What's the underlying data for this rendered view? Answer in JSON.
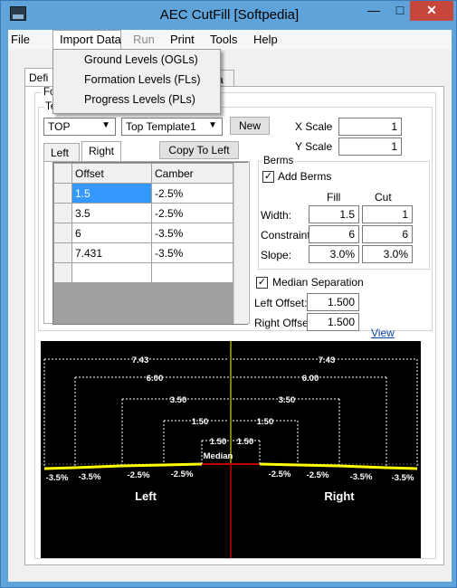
{
  "window": {
    "title": "AEC CutFill [Softpedia]"
  },
  "menu": {
    "items": [
      "File",
      "Import Data",
      "Run",
      "Print",
      "Tools",
      "Help"
    ],
    "dropdown": [
      "Ground Levels (OGLs)",
      "Formation Levels (FLs)",
      "Progress Levels (PLs)"
    ]
  },
  "tabs": {
    "first": "Defi",
    "second": "a"
  },
  "fo_label": "Fo",
  "templates": {
    "group_label": "Templates",
    "template_select": "TOP",
    "template_name_select": "Top Template1",
    "new_button": "New",
    "x_scale_label": "X Scale",
    "x_scale_value": "1",
    "y_scale_label": "Y Scale",
    "y_scale_value": "1",
    "left_tab": "Left",
    "right_tab": "Right",
    "copy_button": "Copy To Left",
    "grid": {
      "headers": [
        "Offset",
        "Camber"
      ],
      "rows": [
        [
          "1.5",
          "-2.5%"
        ],
        [
          "3.5",
          "-2.5%"
        ],
        [
          "6",
          "-3.5%"
        ],
        [
          "7.431",
          "-3.5%"
        ],
        [
          "",
          ""
        ]
      ]
    }
  },
  "berms": {
    "group_label": "Berms",
    "add_berms_label": "Add Berms",
    "fill_header": "Fill",
    "cut_header": "Cut",
    "width_label": "Width:",
    "width_fill": "1.5",
    "width_cut": "1",
    "constraint_label": "Constraint:",
    "constraint_fill": "6",
    "constraint_cut": "6",
    "slope_label": "Slope:",
    "slope_fill": "3.0%",
    "slope_cut": "3.0%"
  },
  "median": {
    "label": "Median  Separation",
    "left_offset_label": "Left Offset:",
    "left_offset_value": "1.500",
    "right_offset_label": "Right Offset:",
    "right_offset_value": "1.500",
    "view_link": "View"
  },
  "diagram": {
    "dims": [
      "7.43",
      "6.00",
      "3.50",
      "1.50",
      "1.50"
    ],
    "median_label": "Median",
    "cambers_left": [
      "-3.5%",
      "-3.5%",
      "-2.5%",
      "-2.5%"
    ],
    "cambers_right": [
      "-2.5%",
      "-2.5%",
      "-3.5%",
      "-3.5%"
    ],
    "left_label": "Left",
    "right_label": "Right",
    "colors": {
      "road": "#ffff00",
      "centerline": "#ffff00",
      "median_line": "#c00000",
      "dims": "#ffffff"
    }
  }
}
